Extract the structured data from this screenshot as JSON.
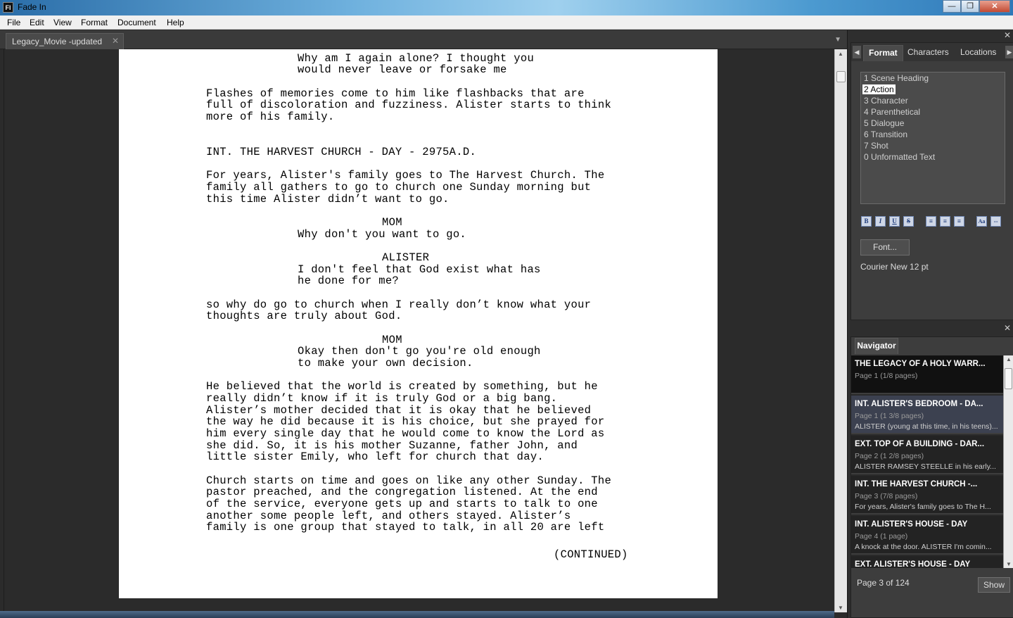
{
  "window": {
    "title": "Fade In",
    "app_icon": "FI",
    "minimize": "—",
    "maximize": "❐",
    "close": "✕"
  },
  "menu": [
    "File",
    "Edit",
    "View",
    "Format",
    "Document",
    "Help"
  ],
  "doc_tab": {
    "label": "Legacy_Movie -updated",
    "close": "✕",
    "dropdown": "▼"
  },
  "script_lines": [
    "Why am I again alone? I thought you",
    "would never leave or forsake me",
    "Flashes of memories come to him like flashbacks that are",
    "full of discoloration and fuzziness. Alister starts to think",
    "more of his family.",
    "INT. THE HARVEST CHURCH - DAY - 2975A.D.",
    "For years, Alister's family goes to The Harvest Church. The",
    "family all gathers to go to church one Sunday morning but",
    "this time Alister didn’t want to go.",
    "MOM",
    "Why don't you want to go.",
    "ALISTER",
    "I don't feel that God exist what has",
    "he done for me?",
    "so why do go to church when I really don’t know what your",
    "thoughts are truly about God.",
    "MOM",
    "Okay then don't go you're old enough",
    "to make your own decision.",
    "He believed that the world is created by something, but he",
    "really didn’t know if it is truly God or a big bang.",
    "Alister’s mother decided that it is okay that he believed",
    "the way he did because it is his choice, but she prayed for",
    "him every single day that he would come to know the Lord as",
    "she did. So, it is his mother Suzanne, father John, and",
    "little sister Emily, who left for church that day.",
    "Church starts on time and goes on like any other Sunday. The",
    "pastor preached, and the congregation listened. At the end",
    "of the service, everyone gets up and starts to talk to one",
    "another some people left, and others stayed. Alister’s",
    "family is one group that stayed to talk, in all 20 are left",
    "(CONTINUED)"
  ],
  "format_panel": {
    "tabs": [
      "Format",
      "Characters",
      "Locations"
    ],
    "elements": [
      "1 Scene Heading",
      "2 Action",
      "3 Character",
      "4 Parenthetical",
      "5 Dialogue",
      "6 Transition",
      "7 Shot",
      "0 Unformatted Text"
    ],
    "selected_element": "2 Action",
    "style_buttons": [
      "B",
      "I",
      "U",
      "S",
      "≡",
      "≡",
      "≡",
      "Aa",
      "⇔"
    ],
    "font_button": "Font...",
    "font_info": "Courier New 12 pt"
  },
  "navigator": {
    "tab": "Navigator",
    "items": [
      {
        "title": "THE LEGACY OF A HOLY WARR...",
        "pages": "Page 1 (1/8 pages)",
        "snippet": ""
      },
      {
        "title": "INT. ALISTER'S BEDROOM - DA...",
        "pages": "Page 1 (1 3/8 pages)",
        "snippet": "ALISTER (young at this time, in his teens)..."
      },
      {
        "title": "EXT. TOP OF A BUILDING - DAR...",
        "pages": "Page 2 (1 2/8 pages)",
        "snippet": "ALISTER RAMSEY STEELLE in his early..."
      },
      {
        "title": "INT. THE HARVEST CHURCH -...",
        "pages": "Page 3 (7/8 pages)",
        "snippet": "For years, Alister's family goes to The H..."
      },
      {
        "title": "INT. ALISTER'S HOUSE - DAY",
        "pages": "Page 4 (1 page)",
        "snippet": "A knock at the door.  ALISTER  I'm comin..."
      },
      {
        "title": "EXT. ALISTER'S HOUSE - DAY",
        "pages": "",
        "snippet": ""
      }
    ],
    "page_count": "Page 3 of 124",
    "show_button": "Show"
  }
}
